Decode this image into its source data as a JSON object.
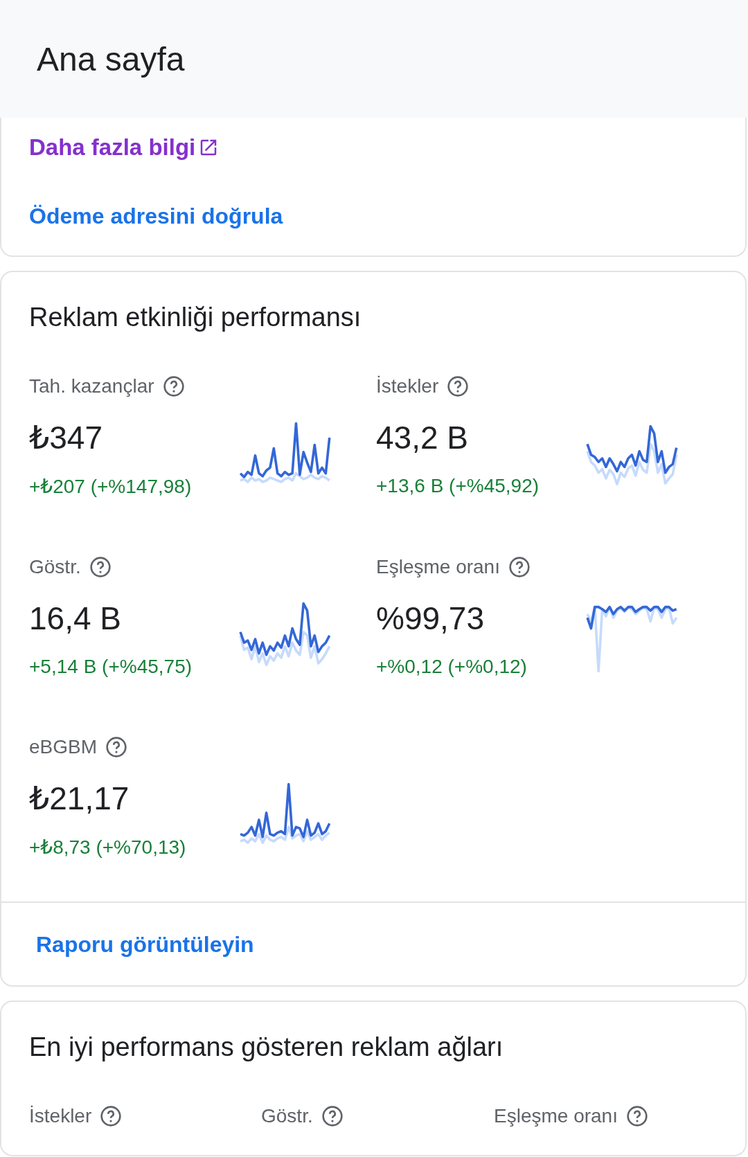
{
  "header": {
    "title": "Ana sayfa"
  },
  "verify_card": {
    "learn_more_link": "Daha fazla bilgi",
    "action_link": "Ödeme adresini doğrula"
  },
  "performance_card": {
    "title": "Reklam etkinliği performansı",
    "metrics": [
      {
        "label": "Tah. kazançlar",
        "value": "₺347",
        "change": "+₺207 (+%147,98)"
      },
      {
        "label": "İstekler",
        "value": "43,2 B",
        "change": "+13,6 B (+%45,92)"
      },
      {
        "label": "Göstr.",
        "value": "16,4 B",
        "change": "+5,14 B (+%45,75)"
      },
      {
        "label": "Eşleşme oranı",
        "value": "%99,73",
        "change": "+%0,12 (+%0,12)"
      },
      {
        "label": "eBGBM",
        "value": "₺21,17",
        "change": "+₺8,73 (+%70,13)"
      }
    ],
    "report_link": "Raporu görüntüleyin"
  },
  "networks_card": {
    "title": "En iyi performans gösteren reklam ağları",
    "columns": [
      "İstekler",
      "Göstr.",
      "Eşleşme oranı"
    ]
  }
}
